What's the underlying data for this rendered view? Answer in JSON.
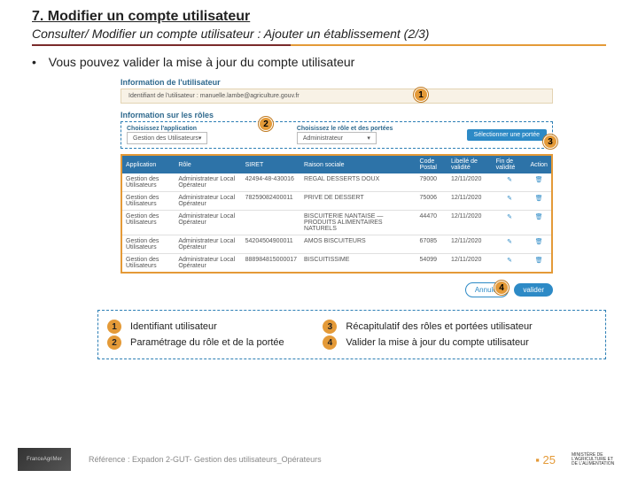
{
  "header": {
    "title": "7. Modifier un compte utilisateur",
    "subtitle": "Consulter/ Modifier un compte utilisateur : Ajouter un établissement (2/3)"
  },
  "bullet": "Vous pouvez valider la mise à jour du compte utilisateur",
  "panel1": {
    "heading": "Information de l'utilisateur",
    "label": "Identifiant de l'utilisateur :",
    "value": "manuelle.lambe@agriculture.gouv.fr"
  },
  "panel2": {
    "heading": "Information sur les rôles",
    "lbl_app": "Choisissez l'application",
    "sel_app": "Gestion des Utilisateurs",
    "lbl_role": "Choisissez le rôle et des portées",
    "sel_role": "Administrateur",
    "btn": "Sélectionner une portée"
  },
  "table": {
    "headers": [
      "Application",
      "Rôle",
      "SIRET",
      "Raison sociale",
      "Code Postal",
      "Libellé de validité",
      "Fin de validité",
      "Action"
    ],
    "rows": [
      {
        "app": "Gestion des Utilisateurs",
        "role": "Administrateur Local Opérateur",
        "siret": "42494-48-430016",
        "raison": "REGAL DESSERTS DOUX",
        "cp": "79000",
        "dv": "12/11/2020"
      },
      {
        "app": "Gestion des Utilisateurs",
        "role": "Administrateur Local Opérateur",
        "siret": "78259082400011",
        "raison": "PRIVE DE DESSERT",
        "cp": "75006",
        "dv": "12/11/2020"
      },
      {
        "app": "Gestion des Utilisateurs",
        "role": "Administrateur Local Opérateur",
        "siret": "",
        "raison": "BISCUITERIE NANTAISE — PRODUITS ALIMENTAIRES NATURELS",
        "cp": "44470",
        "dv": "12/11/2020"
      },
      {
        "app": "Gestion des Utilisateurs",
        "role": "Administrateur Local Opérateur",
        "siret": "54204504900011",
        "raison": "AMOS BISCUITEURS",
        "cp": "67085",
        "dv": "12/11/2020"
      },
      {
        "app": "Gestion des Utilisateurs",
        "role": "Administrateur Local Opérateur",
        "siret": "888984815000017",
        "raison": "BISCUITISSIME",
        "cp": "54099",
        "dv": "12/11/2020"
      }
    ]
  },
  "foot_buttons": {
    "cancel": "Annuler",
    "valider": "valider"
  },
  "markers": {
    "m1": "1",
    "m2": "2",
    "m3": "3",
    "m4": "4"
  },
  "legend": {
    "l1": "Identifiant utilisateur",
    "l2": "Paramétrage du rôle et de la portée",
    "l3": "Récapitulatif des rôles et portées utilisateur",
    "l4": "Valider la mise à jour du compte utilisateur"
  },
  "footer": {
    "ref": "Référence : Expadon 2-GUT- Gestion des utilisateurs_Opérateurs",
    "page_prefix": "▪ ",
    "page": "25",
    "ministry": "MINISTÈRE DE L'AGRICULTURE ET DE L'ALIMENTATION",
    "brand": "FranceAgriMer"
  }
}
